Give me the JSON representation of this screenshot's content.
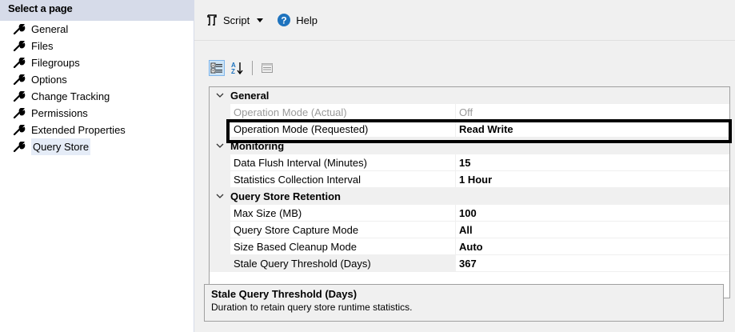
{
  "sidebar": {
    "header": "Select a page",
    "items": [
      {
        "label": "General"
      },
      {
        "label": "Files"
      },
      {
        "label": "Filegroups"
      },
      {
        "label": "Options"
      },
      {
        "label": "Change Tracking"
      },
      {
        "label": "Permissions"
      },
      {
        "label": "Extended Properties"
      },
      {
        "label": "Query Store",
        "selected": true
      }
    ]
  },
  "toolbar": {
    "script_label": "Script",
    "help_label": "Help"
  },
  "grid": {
    "categories": [
      {
        "title": "General",
        "rows": [
          {
            "name": "Operation Mode (Actual)",
            "value": "Off",
            "disabled": true
          },
          {
            "name": "Operation Mode (Requested)",
            "value": "Read Write"
          }
        ]
      },
      {
        "title": "Monitoring",
        "rows": [
          {
            "name": "Data Flush Interval (Minutes)",
            "value": "15"
          },
          {
            "name": "Statistics Collection Interval",
            "value": "1 Hour"
          }
        ]
      },
      {
        "title": "Query Store Retention",
        "rows": [
          {
            "name": "Max Size (MB)",
            "value": "100"
          },
          {
            "name": "Query Store Capture Mode",
            "value": "All"
          },
          {
            "name": "Size Based Cleanup Mode",
            "value": "Auto"
          },
          {
            "name": "Stale Query Threshold (Days)",
            "value": "367",
            "selected": true
          }
        ]
      }
    ]
  },
  "description": {
    "title": "Stale Query Threshold (Days)",
    "text": "Duration to retain query store runtime statistics."
  },
  "colors": {
    "panel_bg": "#f0f0f0",
    "header_bg": "#d6dbe9",
    "help_blue": "#1e73be",
    "disabled_text": "#9a9a9a"
  }
}
